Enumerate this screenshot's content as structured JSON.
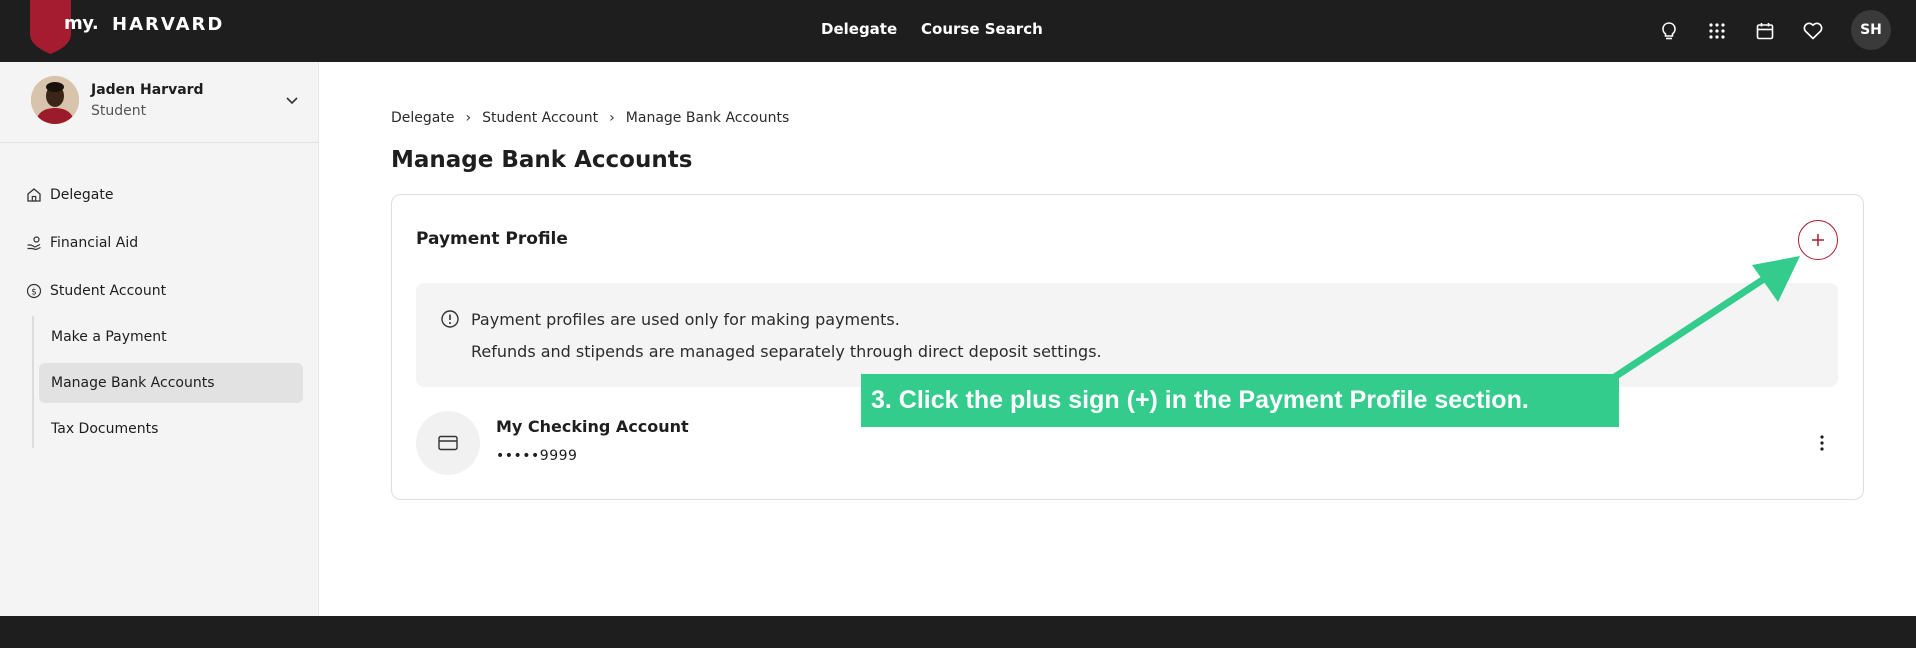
{
  "header": {
    "logo_my": "my.",
    "logo_text": "HARVARD",
    "nav": [
      "Delegate",
      "Course Search"
    ],
    "icons": [
      "lightbulb-icon",
      "apps-grid-icon",
      "calendar-icon",
      "heart-icon"
    ],
    "avatar_initials": "SH"
  },
  "sidebar": {
    "user_name": "Jaden Harvard",
    "user_role": "Student",
    "items": [
      {
        "label": "Delegate",
        "icon": "home-icon"
      },
      {
        "label": "Financial Aid",
        "icon": "hand-coins-icon"
      },
      {
        "label": "Student Account",
        "icon": "dollar-circle-icon"
      }
    ],
    "sub_items": [
      {
        "label": "Make a Payment"
      },
      {
        "label": "Manage Bank Accounts",
        "active": true
      },
      {
        "label": "Tax Documents"
      }
    ]
  },
  "breadcrumb": [
    "Delegate",
    "Student Account",
    "Manage Bank Accounts"
  ],
  "page_title": "Manage Bank Accounts",
  "payment_profile": {
    "title": "Payment Profile",
    "info_line1": "Payment profiles are used only for making payments.",
    "info_line2": "Refunds and stipends are managed separately through direct deposit settings.",
    "account_name": "My Checking Account",
    "account_number": "•••••9999"
  },
  "annotation": {
    "text": "3. Click the plus sign (+) in the Payment Profile section.",
    "color": "#33cc8c"
  },
  "colors": {
    "brand": "#a51c30",
    "topbar": "#1e1e1e",
    "sidebar_bg": "#f4f4f4"
  }
}
